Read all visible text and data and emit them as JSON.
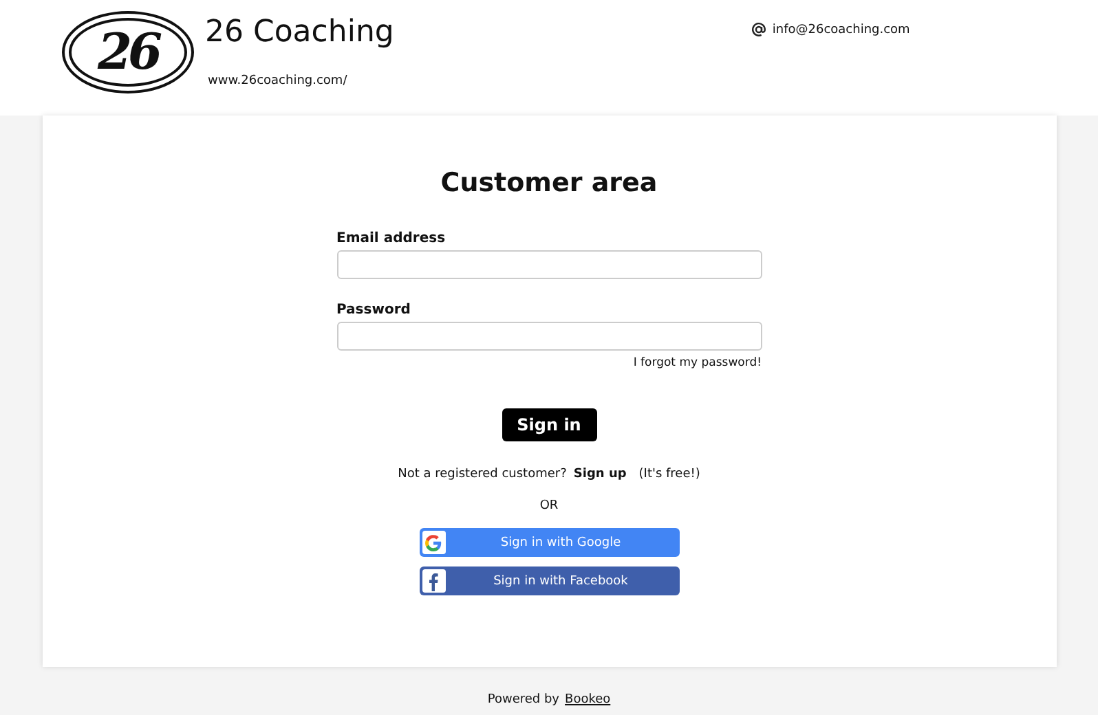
{
  "header": {
    "logo_text": "26",
    "brand": "26 Coaching",
    "website": "www.26coaching.com/",
    "email": "info@26coaching.com"
  },
  "form": {
    "title": "Customer area",
    "fields": [
      {
        "label": "Email address"
      },
      {
        "label": "Password"
      }
    ],
    "forgot_link": "I forgot my password!",
    "submit": "Sign in",
    "signup": {
      "prompt": "Not a registered customer?",
      "link": "Sign up",
      "note": "(It's free!)"
    },
    "separator": "OR",
    "social": [
      {
        "kind": "google",
        "label": "Sign in with Google"
      },
      {
        "kind": "facebook",
        "label": "Sign in with Facebook"
      }
    ]
  },
  "footer": {
    "prefix": "Powered by",
    "link": "Bookeo"
  }
}
